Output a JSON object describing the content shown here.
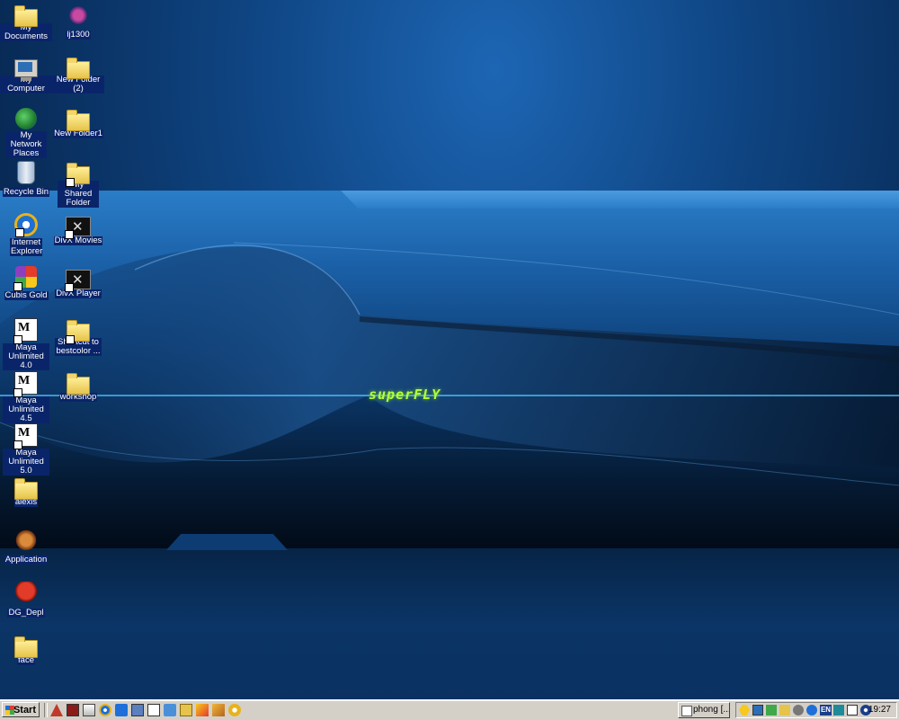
{
  "wallpaper": {
    "logo_text": "superFLY"
  },
  "desktop_icons": [
    {
      "label": "My Documents",
      "icon": "my-documents-icon"
    },
    {
      "label": "My Computer",
      "icon": "my-computer-icon"
    },
    {
      "label": "My Network Places",
      "icon": "network-places-icon"
    },
    {
      "label": "Recycle Bin",
      "icon": "recycle-bin-icon"
    },
    {
      "label": "Internet Explorer",
      "icon": "internet-explorer-icon"
    },
    {
      "label": "Cubis Gold",
      "icon": "cubis-gold-icon"
    },
    {
      "label": "Maya Unlimited 4.0",
      "icon": "maya-icon"
    },
    {
      "label": "Maya Unlimited 4.5",
      "icon": "maya-icon"
    },
    {
      "label": "Maya Unlimited 5.0",
      "icon": "maya-icon"
    },
    {
      "label": "alexis",
      "icon": "folder-icon"
    },
    {
      "label": "Application",
      "icon": "application-icon"
    },
    {
      "label": "DG_Depl",
      "icon": "skull-icon"
    },
    {
      "label": "face",
      "icon": "folder-icon"
    },
    {
      "label": "lj1300",
      "icon": "printer-app-icon"
    },
    {
      "label": "New Folder (2)",
      "icon": "folder-icon"
    },
    {
      "label": "New Folder1",
      "icon": "folder-icon"
    },
    {
      "label": "My Shared Folder",
      "icon": "shared-folder-icon"
    },
    {
      "label": "DivX Movies",
      "icon": "divx-icon"
    },
    {
      "label": "DivX Player",
      "icon": "divx-icon"
    },
    {
      "label": "Shortcut to bestcolor ...",
      "icon": "shortcut-folder-icon"
    },
    {
      "label": "workshop",
      "icon": "folder-icon"
    }
  ],
  "taskbar": {
    "start_label": "Start",
    "task_button_label": "phong [...",
    "tray_language": "EN",
    "clock": "19:27"
  },
  "colors": {
    "selection": "#0a246a",
    "taskbar": "#d4d0c8",
    "logo": "#b6ff3a"
  }
}
